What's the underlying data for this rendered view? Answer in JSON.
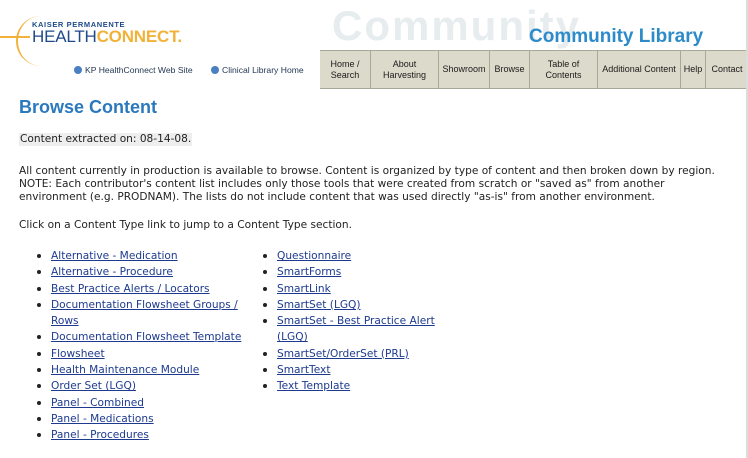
{
  "header": {
    "brand_top": "KAISER PERMANENTE",
    "brand_health": "HEALTH",
    "brand_connect": "CONNECT.",
    "links": [
      "KP HealthConnect Web Site",
      "Clinical Library Home"
    ],
    "watermark": "Community",
    "site_title": "Community Library",
    "nav": [
      "Home / Search",
      "About Harvesting",
      "Showroom",
      "Browse",
      "Table of Contents",
      "Additional Content",
      "Help",
      "Contact"
    ]
  },
  "main": {
    "title": "Browse Content",
    "extracted_on": "Content extracted on: 08-14-08.",
    "intro": "All content currently in production is available to browse. Content is organized by type of content and then broken down by region. NOTE: Each contributor's content list includes only those tools that were created from scratch or \"saved as\" from another environment (e.g. PRODNAM). The lists do not include content that was used directly \"as-is\" from another environment.",
    "click_hint": "Click on a Content Type link to jump to a Content Type section.",
    "content_types_left": [
      "Alternative - Medication",
      "Alternative - Procedure",
      "Best Practice Alerts / Locators",
      "Documentation Flowsheet Groups / Rows",
      "Documentation Flowsheet Template",
      "Flowsheet",
      "Health Maintenance Module",
      "Order Set (LGQ)",
      "Panel - Combined",
      "Panel - Medications",
      "Panel - Procedures"
    ],
    "content_types_right": [
      "Questionnaire",
      "SmartForms",
      "SmartLink",
      "SmartSet (LGQ)",
      "SmartSet - Best Practice Alert (LGQ)",
      "SmartSet/OrderSet (PRL)",
      "SmartText",
      "Text Template"
    ]
  },
  "colors": {
    "title_blue": "#2a78bd",
    "link_blue": "#1d3a8f",
    "brand_navy": "#1f4a8a",
    "brand_gold": "#f2b23a",
    "nav_bg": "#dcdacb"
  }
}
